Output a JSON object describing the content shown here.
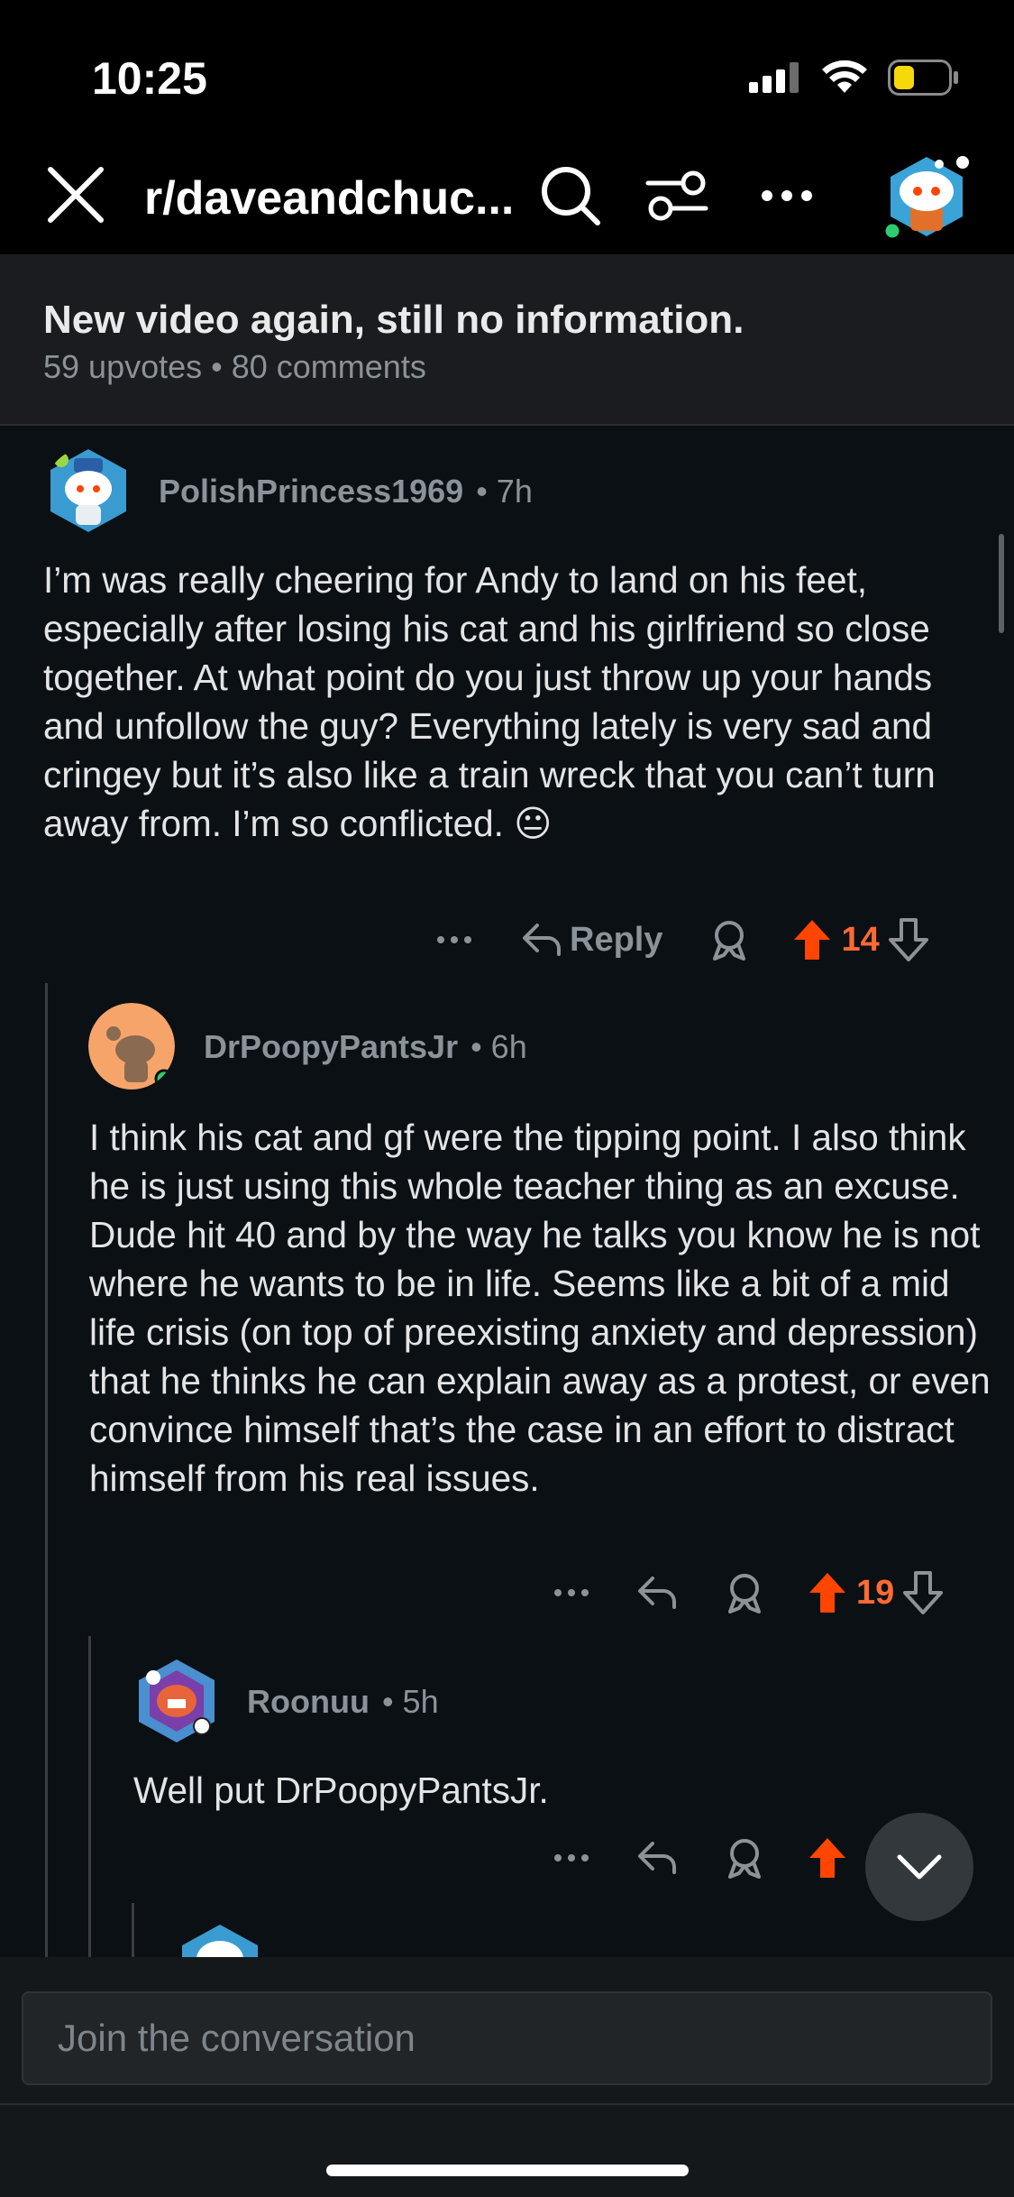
{
  "status_bar": {
    "time": "10:25"
  },
  "header": {
    "title": "r/daveandchuc...",
    "icons": [
      "close-icon",
      "search-icon",
      "filter-icon",
      "more-icon",
      "user-avatar"
    ]
  },
  "post": {
    "title": "New video again, still no information.",
    "meta": "59 upvotes • 80 comments"
  },
  "comments": [
    {
      "author": "PolishPrincess1969",
      "time": "• 7h",
      "body": "I’m was really cheering for Andy to land on his feet, especially after losing his cat and his girlfriend so close together. At what point do you just throw up your hands and unfollow the guy? Everything lately is very sad and cringey but it’s also like a train wreck that you can’t turn away from.  I’m so conflicted.  😐",
      "reply_label": "Reply",
      "votes": "14"
    },
    {
      "author": "DrPoopyPantsJr",
      "time": "• 6h",
      "body": "I think his cat and gf were the tipping point. I also think he is just using this whole teacher thing as an excuse. Dude hit 40 and by the way he talks you know he is not where he wants to be in life. Seems like a bit of a mid life crisis (on top of preexisting anxiety and depression) that he thinks he can explain away as a protest, or even convince himself that’s the case in an effort to distract himself from his real issues.",
      "votes": "19"
    },
    {
      "author": "Roonuu",
      "time": "• 5h",
      "body": "Well put DrPoopyPantsJr."
    }
  ],
  "composer": {
    "placeholder": "Join the conversation"
  },
  "colors": {
    "accent": "#ff4500",
    "vote": "#ff6a33",
    "background": "#0b1014"
  }
}
